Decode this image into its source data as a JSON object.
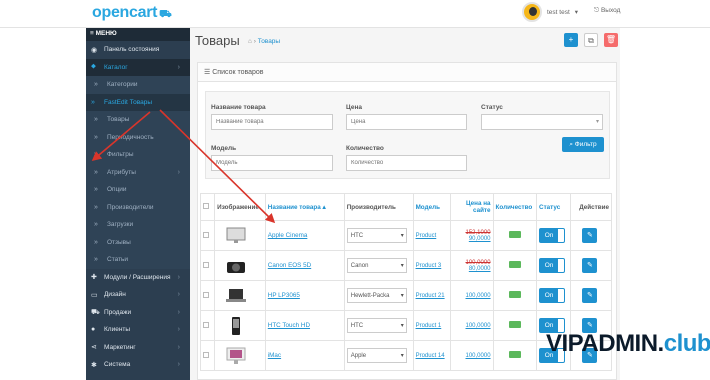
{
  "topbar": {
    "logo": "opencart",
    "user_name": "test test",
    "user_caret": "▾",
    "logout": "Выход"
  },
  "sidebar": {
    "menu_label": "≡ МЕНЮ",
    "items": [
      {
        "icon": "dashboard-icon",
        "glyph": "◉",
        "label": "Панель состояния",
        "type": "top",
        "chev": ""
      },
      {
        "icon": "tag-icon",
        "glyph": "⬥",
        "label": "Каталог",
        "type": "catalog",
        "chev": "›"
      },
      {
        "icon": "",
        "glyph": "»",
        "label": "Категории",
        "type": "sub",
        "chev": ""
      },
      {
        "icon": "",
        "glyph": "»",
        "label": "FastEdit Товары",
        "type": "active",
        "chev": ""
      },
      {
        "icon": "",
        "glyph": "»",
        "label": "Товары",
        "type": "sub",
        "chev": ""
      },
      {
        "icon": "",
        "glyph": "»",
        "label": "Периодичность",
        "type": "sub",
        "chev": ""
      },
      {
        "icon": "",
        "glyph": "»",
        "label": "Фильтры",
        "type": "sub",
        "chev": ""
      },
      {
        "icon": "",
        "glyph": "»",
        "label": "Атрибуты",
        "type": "sub",
        "chev": "›"
      },
      {
        "icon": "",
        "glyph": "»",
        "label": "Опции",
        "type": "sub",
        "chev": ""
      },
      {
        "icon": "",
        "glyph": "»",
        "label": "Производители",
        "type": "sub",
        "chev": ""
      },
      {
        "icon": "",
        "glyph": "»",
        "label": "Загрузки",
        "type": "sub",
        "chev": ""
      },
      {
        "icon": "",
        "glyph": "»",
        "label": "Отзывы",
        "type": "sub",
        "chev": ""
      },
      {
        "icon": "",
        "glyph": "»",
        "label": "Статьи",
        "type": "sub",
        "chev": ""
      },
      {
        "icon": "puzzle-icon",
        "glyph": "✚",
        "label": "Модули / Расширения",
        "type": "top",
        "chev": "›"
      },
      {
        "icon": "desktop-icon",
        "glyph": "▭",
        "label": "Дизайн",
        "type": "top",
        "chev": "›"
      },
      {
        "icon": "cart-icon",
        "glyph": "⛟",
        "label": "Продажи",
        "type": "top",
        "chev": "›"
      },
      {
        "icon": "user-icon",
        "glyph": "●",
        "label": "Клиенты",
        "type": "top",
        "chev": "›"
      },
      {
        "icon": "share-icon",
        "glyph": "⋖",
        "label": "Маркетинг",
        "type": "top",
        "chev": "›"
      },
      {
        "icon": "cog-icon",
        "glyph": "✱",
        "label": "Система",
        "type": "top",
        "chev": "›"
      }
    ]
  },
  "header": {
    "title": "Товары",
    "home_glyph": "⌂",
    "breadcrumb_sep": "›",
    "breadcrumb": "Товары",
    "btn_add": "+",
    "btn_copy": "⧉",
    "btn_delete": "🗑"
  },
  "panel": {
    "title": "Список товаров",
    "list_glyph": "☰"
  },
  "filter": {
    "name_label": "Название товара",
    "name_placeholder": "Название товара",
    "price_label": "Цена",
    "price_placeholder": "Цена",
    "status_label": "Статус",
    "status_value": "",
    "model_label": "Модель",
    "model_placeholder": "Модель",
    "qty_label": "Количество",
    "qty_placeholder": "Количество",
    "button": "⌕ Фильтр"
  },
  "table": {
    "headers": {
      "image": "Изображение",
      "name": "Название товара ▴",
      "manufacturer": "Производитель",
      "model": "Модель",
      "price": "Цена на сайте",
      "quantity": "Количество",
      "status": "Статус",
      "action": "Действие"
    },
    "rows": [
      {
        "name": "Apple Cinema",
        "manufacturer": "HTC",
        "model": "Product",
        "price_old": "152,1000",
        "price": "90,0000",
        "status": "On",
        "thumb": "monitor"
      },
      {
        "name": "Canon EOS 5D",
        "manufacturer": "Canon",
        "model": "Product 3",
        "price_old": "100,0000",
        "price": "80,0000",
        "status": "On",
        "thumb": "camera"
      },
      {
        "name": "HP LP3065",
        "manufacturer": "Hewlett-Packa",
        "model": "Product 21",
        "price_old": "",
        "price": "100,0000",
        "status": "On",
        "thumb": "laptop"
      },
      {
        "name": "HTC Touch HD",
        "manufacturer": "HTC",
        "model": "Product 1",
        "price_old": "",
        "price": "100,0000",
        "status": "On",
        "thumb": "phone"
      },
      {
        "name": "iMac",
        "manufacturer": "Apple",
        "model": "Product 14",
        "price_old": "",
        "price": "100,0000",
        "status": "On",
        "thumb": "imac"
      }
    ],
    "edit_glyph": "✎"
  },
  "watermark": {
    "main": "VIPADMIN.",
    "accent": "club"
  },
  "colors": {
    "accent": "#1e91cf",
    "sidebar": "#2c3e50",
    "danger": "#f56b6b",
    "success": "#5cb85c",
    "arrow": "#d9352b"
  }
}
